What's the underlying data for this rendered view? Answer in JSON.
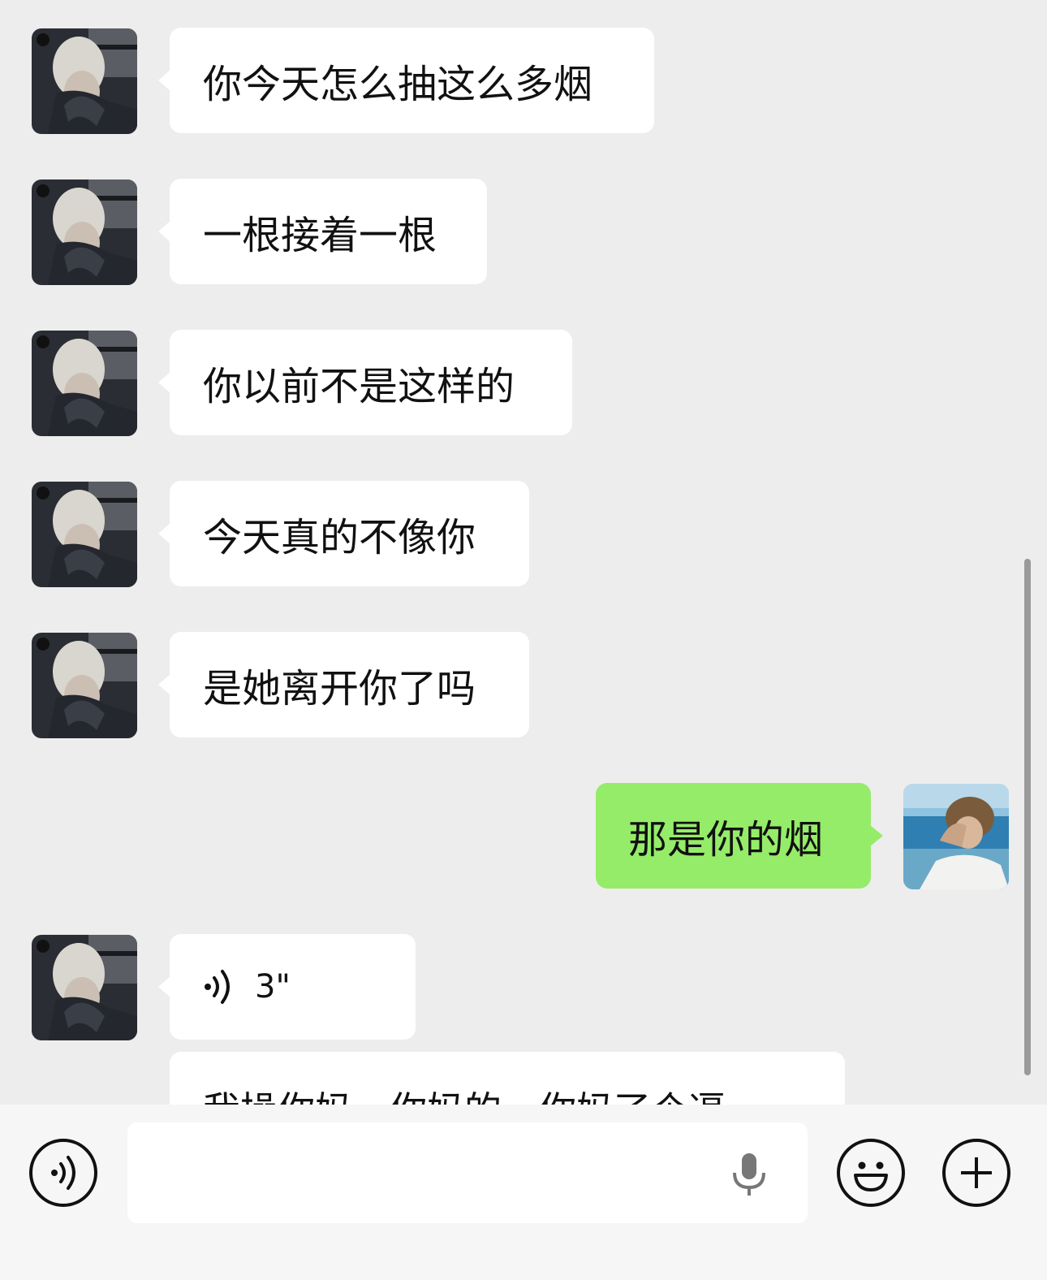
{
  "messages": [
    {
      "side": "in",
      "text": "你今天怎么抽这么多烟"
    },
    {
      "side": "in",
      "text": "一根接着一根"
    },
    {
      "side": "in",
      "text": "你以前不是这样的"
    },
    {
      "side": "in",
      "text": "今天真的不像你"
    },
    {
      "side": "in",
      "text": "是她离开你了吗"
    },
    {
      "side": "out",
      "text": "那是你的烟"
    },
    {
      "side": "in",
      "type": "voice",
      "duration": "3\""
    }
  ],
  "transcript": {
    "text": "我操你妈，你妈的，你妈了个逼"
  },
  "input_bar": {
    "left_icon": "voice-mode-icon",
    "mic_icon": "microphone-icon",
    "emoji_icon": "emoji-icon",
    "plus_icon": "plus-icon"
  },
  "colors": {
    "background": "#ededed",
    "incoming_bubble": "#ffffff",
    "outgoing_bubble": "#95ec69",
    "input_bar": "#f6f6f6"
  }
}
